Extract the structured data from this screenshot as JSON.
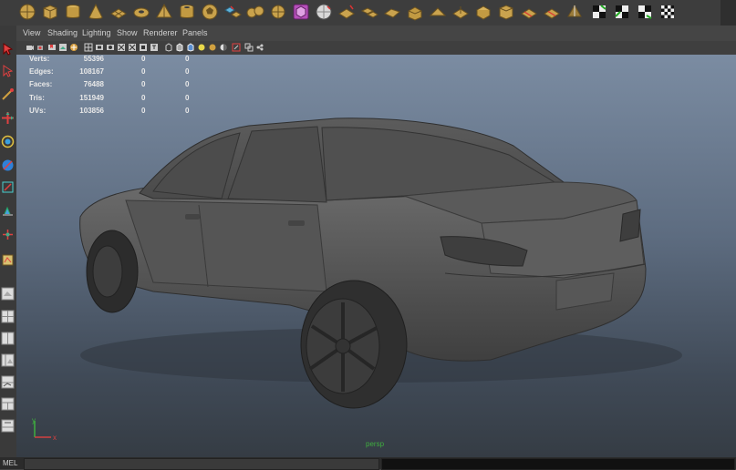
{
  "panel_menu": [
    "View",
    "Shading",
    "Lighting",
    "Show",
    "Renderer",
    "Panels"
  ],
  "hud": {
    "rows": [
      {
        "label": "Verts:",
        "count": "55396",
        "sel": "0",
        "comp": "0"
      },
      {
        "label": "Edges:",
        "count": "108167",
        "sel": "0",
        "comp": "0"
      },
      {
        "label": "Faces:",
        "count": "76488",
        "sel": "0",
        "comp": "0"
      },
      {
        "label": "Tris:",
        "count": "151949",
        "sel": "0",
        "comp": "0"
      },
      {
        "label": "UVs:",
        "count": "103856",
        "sel": "0",
        "comp": "0"
      }
    ]
  },
  "viewport": {
    "camera_label": "persp",
    "axis_y": "y",
    "axis_x": "x"
  },
  "statusbar": {
    "cmd_label": "MEL"
  },
  "colors": {
    "shelf_bg": "#3d3d3d",
    "viewport_top": "#7b8ca2",
    "viewport_bottom": "#353c44",
    "hud_text": "#e8e8e8",
    "camera_label": "#3fae3f"
  }
}
